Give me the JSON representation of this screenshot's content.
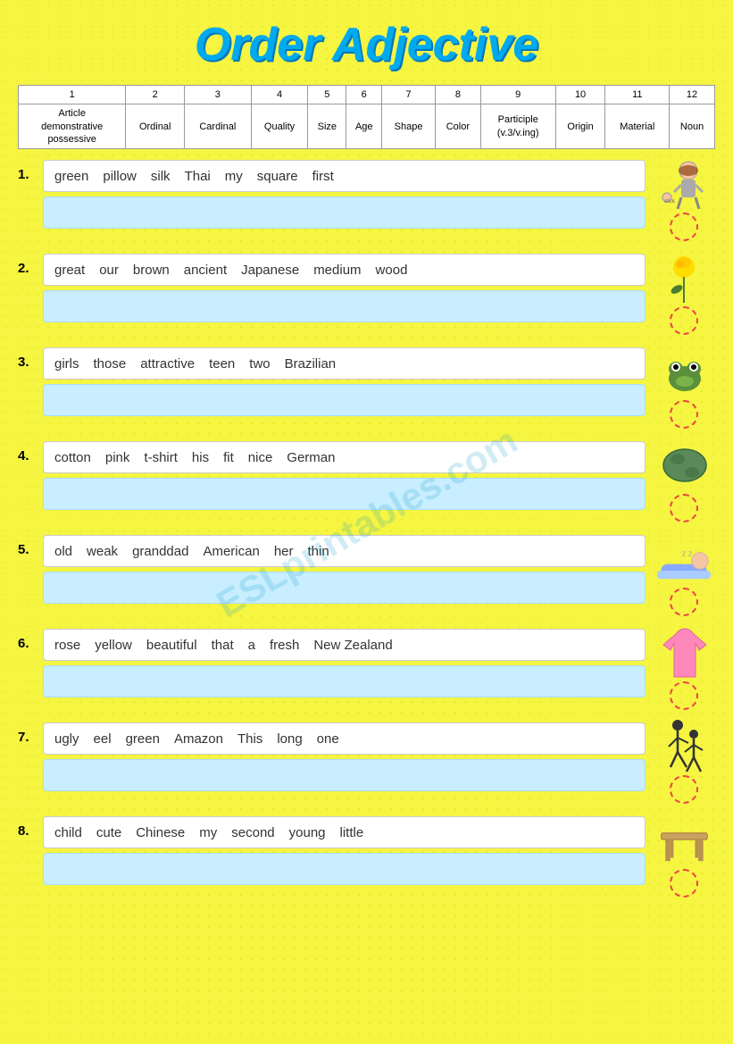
{
  "title": "Order Adjective",
  "header": {
    "columns": [
      {
        "num": "1",
        "label": "Article\ndemonstrative\npossessive"
      },
      {
        "num": "2",
        "label": "Ordinal"
      },
      {
        "num": "3",
        "label": "Cardinal"
      },
      {
        "num": "4",
        "label": "Quality"
      },
      {
        "num": "5",
        "label": "Size"
      },
      {
        "num": "6",
        "label": "Age"
      },
      {
        "num": "7",
        "label": "Shape"
      },
      {
        "num": "8",
        "label": "Color"
      },
      {
        "num": "9",
        "label": "Participle\n(v.3/v.ing)"
      },
      {
        "num": "10",
        "label": "Origin"
      },
      {
        "num": "11",
        "label": "Material"
      },
      {
        "num": "12",
        "label": "Noun"
      }
    ]
  },
  "exercises": [
    {
      "number": "1.",
      "words": [
        "green",
        "pillow",
        "silk",
        "Thai",
        "my",
        "square",
        "first"
      ],
      "icon": "old-man"
    },
    {
      "number": "2.",
      "words": [
        "great",
        "our",
        "brown",
        "ancient",
        "Japanese",
        "medium",
        "wood"
      ],
      "icon": "rose"
    },
    {
      "number": "3.",
      "words": [
        "girls",
        "those",
        "attractive",
        "teen",
        "two",
        "Brazilian"
      ],
      "icon": "frog"
    },
    {
      "number": "4.",
      "words": [
        "cotton",
        "pink",
        "t-shirt",
        "his",
        "fit",
        "nice",
        "German"
      ],
      "icon": "pillow"
    },
    {
      "number": "5.",
      "words": [
        "old",
        "weak",
        "granddad",
        "American",
        "her",
        "thin"
      ],
      "icon": "sleeping"
    },
    {
      "number": "6.",
      "words": [
        "rose",
        "yellow",
        "beautiful",
        "that",
        "a",
        "fresh",
        "New Zealand"
      ],
      "icon": "tshirt"
    },
    {
      "number": "7.",
      "words": [
        "ugly",
        "eel",
        "green",
        "Amazon",
        "This",
        "long",
        "one"
      ],
      "icon": "dancers"
    },
    {
      "number": "8.",
      "words": [
        "child",
        "cute",
        "Chinese",
        "my",
        "second",
        "young",
        "little"
      ],
      "icon": "table"
    }
  ],
  "watermark": "ESLprintables.com"
}
